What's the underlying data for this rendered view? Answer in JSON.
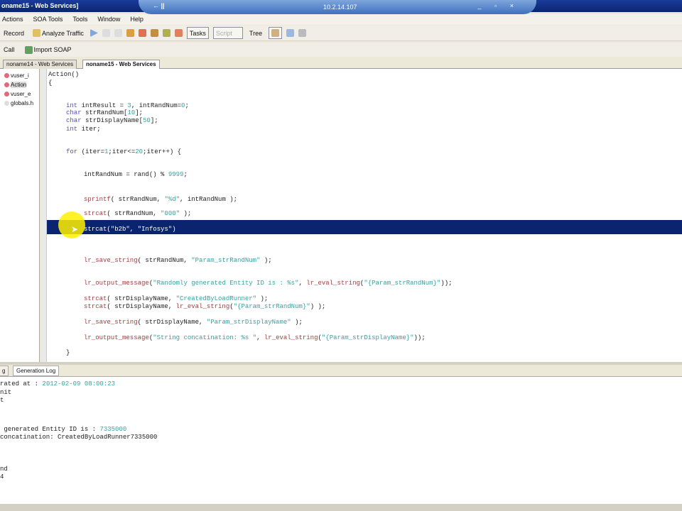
{
  "window": {
    "title": "oname15 - Web Services]",
    "remote_host": "10.2.14.107",
    "pin_label": "← ||"
  },
  "menu": [
    "Actions",
    "SOA Tools",
    "Tools",
    "Window",
    "Help"
  ],
  "toolbar": {
    "record": "Record",
    "analyze": "Analyze Traffic",
    "tasks": "Tasks",
    "script": "Script",
    "tree": "Tree"
  },
  "toolbar2": {
    "call": "Call",
    "import_soap": "Import SOAP"
  },
  "doc_tabs": [
    "noname14 - Web Services",
    "noname15 - Web Services"
  ],
  "tree": [
    "vuser_i",
    "Action",
    "vuser_e",
    "globals.h"
  ],
  "code": [
    [
      [
        "id",
        "Action()"
      ]
    ],
    [
      [
        "id",
        "{"
      ]
    ],
    [
      [
        "kw",
        "int "
      ],
      [
        "id",
        "intResult = "
      ],
      [
        "num",
        "3"
      ],
      [
        "id",
        ", intRandNum="
      ],
      [
        "num",
        "0"
      ],
      [
        "id",
        ";"
      ]
    ],
    [
      [
        "kw",
        "char "
      ],
      [
        "id",
        "strRandNum["
      ],
      [
        "num",
        "10"
      ],
      [
        "id",
        "];"
      ]
    ],
    [
      [
        "kw",
        "char "
      ],
      [
        "id",
        "strDisplayName["
      ],
      [
        "num",
        "50"
      ],
      [
        "id",
        "];"
      ]
    ],
    [
      [
        "kw",
        "int "
      ],
      [
        "id",
        "iter;"
      ]
    ],
    [
      [
        "kw",
        "for "
      ],
      [
        "id",
        "(iter="
      ],
      [
        "num",
        "1"
      ],
      [
        "id",
        ";iter<="
      ],
      [
        "num",
        "20"
      ],
      [
        "id",
        ";iter++) {"
      ]
    ],
    [
      [
        "id",
        "intRandNum = rand() % "
      ],
      [
        "num",
        "9999"
      ],
      [
        "id",
        ";"
      ]
    ],
    [
      [
        "fn",
        "sprintf"
      ],
      [
        "id",
        "( strRandNum, "
      ],
      [
        "str",
        "\"%d\""
      ],
      [
        "id",
        ", intRandNum );"
      ]
    ],
    [
      [
        "fn",
        "strcat"
      ],
      [
        "id",
        "( strRandNum, "
      ],
      [
        "str",
        "\"000\""
      ],
      [
        "id",
        " );"
      ]
    ],
    [
      [
        "id",
        "strcat(\"b2b\", \"Infosys\")"
      ]
    ],
    [
      [
        "fn",
        "lr_save_string"
      ],
      [
        "id",
        "( strRandNum, "
      ],
      [
        "str",
        "\"Param_strRandNum\""
      ],
      [
        "id",
        " );"
      ]
    ],
    [
      [
        "fn",
        "lr_output_message"
      ],
      [
        "id",
        "("
      ],
      [
        "str",
        "\"Randomly generated Entity ID is : %s\""
      ],
      [
        "id",
        ", "
      ],
      [
        "fn",
        "lr_eval_string"
      ],
      [
        "id",
        "("
      ],
      [
        "str",
        "\"{Param_strRandNum}\""
      ],
      [
        "id",
        "));"
      ]
    ],
    [
      [
        "fn",
        "strcat"
      ],
      [
        "id",
        "( strDisplayName, "
      ],
      [
        "str",
        "\"CreatedByLoadRunner\""
      ],
      [
        "id",
        " );"
      ]
    ],
    [
      [
        "fn",
        "strcat"
      ],
      [
        "id",
        "( strDisplayName, "
      ],
      [
        "fn",
        "lr_eval_string"
      ],
      [
        "id",
        "("
      ],
      [
        "str",
        "\"{Param_strRandNum}\""
      ],
      [
        "id",
        ") );"
      ]
    ],
    [
      [
        "fn",
        "lr_save_string"
      ],
      [
        "id",
        "( strDisplayName, "
      ],
      [
        "str",
        "\"Param_strDisplayName\""
      ],
      [
        "id",
        " );"
      ]
    ],
    [
      [
        "fn",
        "lr_output_message"
      ],
      [
        "id",
        "("
      ],
      [
        "str",
        "\"String concatination: %s \""
      ],
      [
        "id",
        ", "
      ],
      [
        "fn",
        "lr_eval_string"
      ],
      [
        "id",
        "("
      ],
      [
        "str",
        "\"{Param_strDisplayName}\""
      ],
      [
        "id",
        "));"
      ]
    ],
    [
      [
        "id",
        "}"
      ]
    ]
  ],
  "bottom_tabs": [
    "g",
    "Generation Log"
  ],
  "output": [
    [
      [
        "id",
        "rated at : "
      ],
      [
        "str",
        "2012-02-09 08:00:23"
      ]
    ],
    [
      [
        "id",
        "nit"
      ]
    ],
    [
      [
        "id",
        "t"
      ]
    ],
    [
      [
        "id",
        " generated Entity ID is : "
      ],
      [
        "str",
        "7335000"
      ]
    ],
    [
      [
        "id",
        "concatination: CreatedByLoadRunner7335000"
      ]
    ],
    [
      [
        "id",
        "nd"
      ]
    ],
    [
      [
        "id",
        "4"
      ]
    ]
  ]
}
